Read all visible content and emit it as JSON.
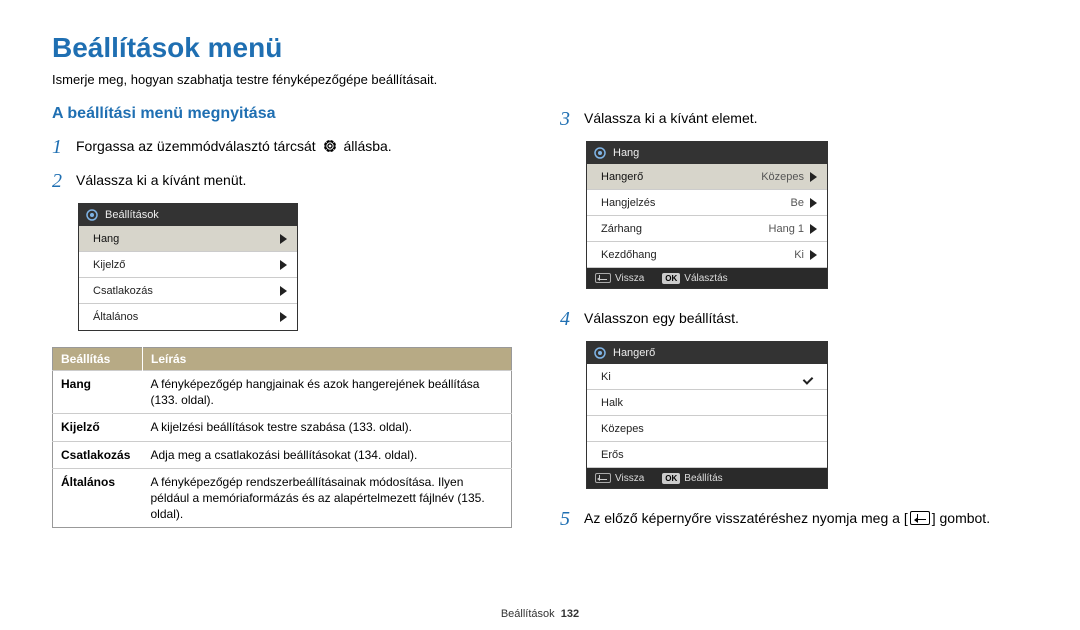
{
  "page": {
    "title": "Beállítások menü",
    "subtitle": "Ismerje meg, hogyan szabhatja testre fényképezőgépe beállításait.",
    "footer_label": "Beállítások",
    "footer_page": "132"
  },
  "left": {
    "section_title": "A beállítási menü megnyitása",
    "step1_num": "1",
    "step1_a": "Forgassa az üzemmódválasztó tárcsát ",
    "step1_b": " állásba.",
    "step2_num": "2",
    "step2_text": "Válassza ki a kívánt menüt.",
    "menu_header": "Beállítások",
    "menu_items": [
      "Hang",
      "Kijelző",
      "Csatlakozás",
      "Általános"
    ],
    "table": {
      "col1": "Beállítás",
      "col2": "Leírás",
      "rows": [
        {
          "name": "Hang",
          "desc": "A fényképezőgép hangjainak és azok hangerejének beállítása (133. oldal)."
        },
        {
          "name": "Kijelző",
          "desc": "A kijelzési beállítások testre szabása (133. oldal)."
        },
        {
          "name": "Csatlakozás",
          "desc": "Adja meg a csatlakozási beállításokat (134. oldal)."
        },
        {
          "name": "Általános",
          "desc": "A fényképezőgép rendszerbeállításainak módosítása. Ilyen például a memóriaformázás és az alapértelmezett fájlnév (135. oldal)."
        }
      ]
    }
  },
  "right": {
    "step3_num": "3",
    "step3_text": "Válassza ki a kívánt elemet.",
    "panel1": {
      "header": "Hang",
      "rows": [
        {
          "label": "Hangerő",
          "value": "Közepes",
          "selected": true
        },
        {
          "label": "Hangjelzés",
          "value": "Be"
        },
        {
          "label": "Zárhang",
          "value": "Hang 1"
        },
        {
          "label": "Kezdőhang",
          "value": "Ki"
        }
      ],
      "footer_back": "Vissza",
      "footer_ok": "Választás"
    },
    "step4_num": "4",
    "step4_text": "Válasszon egy beállítást.",
    "panel2": {
      "header": "Hangerő",
      "rows": [
        {
          "label": "Ki",
          "checked": true
        },
        {
          "label": "Halk"
        },
        {
          "label": "Közepes"
        },
        {
          "label": "Erős"
        }
      ],
      "footer_back": "Vissza",
      "footer_ok": "Beállítás"
    },
    "step5_num": "5",
    "step5_a": "Az előző képernyőre visszatéréshez nyomja meg a [",
    "step5_b": "] gombot."
  }
}
